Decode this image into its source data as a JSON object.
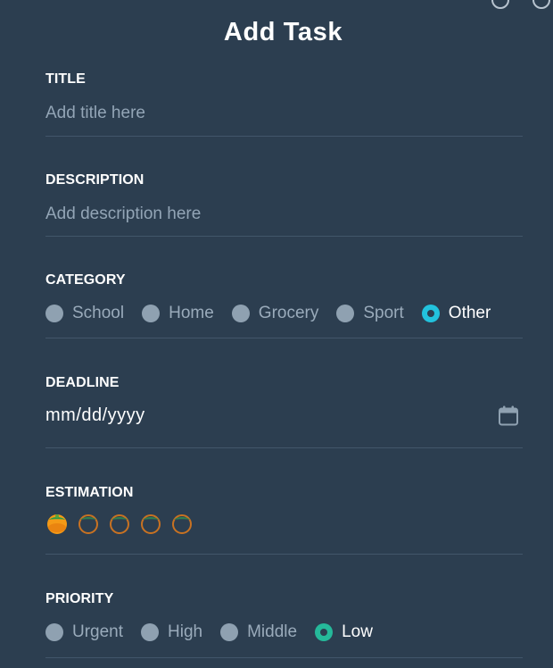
{
  "header": {
    "title": "Add Task"
  },
  "fields": {
    "title": {
      "label": "TITLE",
      "placeholder": "Add title here"
    },
    "description": {
      "label": "DESCRIPTION",
      "placeholder": "Add description here"
    },
    "category": {
      "label": "CATEGORY",
      "options": [
        "School",
        "Home",
        "Grocery",
        "Sport",
        "Other"
      ],
      "selected": "Other"
    },
    "deadline": {
      "label": "DEADLINE",
      "value": "mm/dd/yyyy"
    },
    "estimation": {
      "label": "ESTIMATION",
      "filled": 1,
      "total": 5
    },
    "priority": {
      "label": "PRIORITY",
      "options": [
        "Urgent",
        "High",
        "Middle",
        "Low"
      ],
      "selected": "Low"
    }
  },
  "colors": {
    "background": "#2c3e50",
    "accent_cyan": "#22c2dd",
    "accent_green": "#25b99a",
    "muted_text": "#93a5b6"
  }
}
